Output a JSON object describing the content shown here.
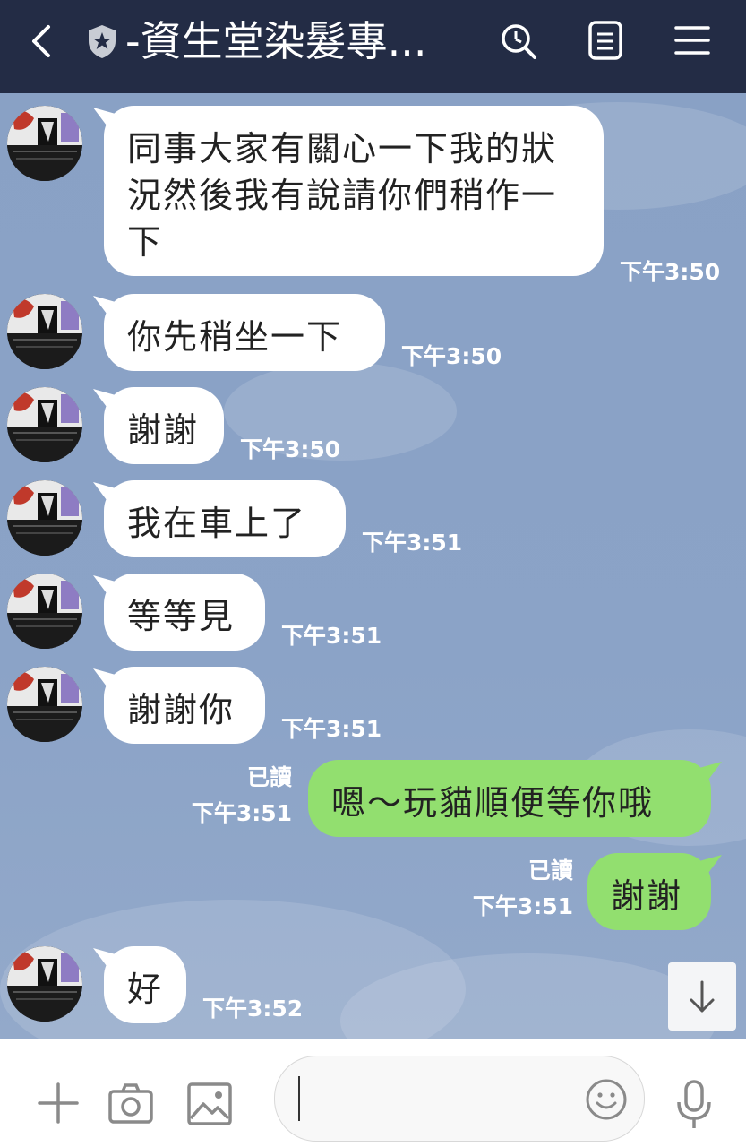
{
  "header": {
    "title": "-資生堂染髮專..."
  },
  "icons": {
    "back": "back-chevron-icon",
    "verified": "shield-star-icon",
    "search": "search-icon",
    "notes": "notes-icon",
    "menu": "menu-icon",
    "scroll_down": "arrow-down-icon",
    "add": "plus-icon",
    "camera": "camera-icon",
    "image": "image-icon",
    "emoji": "emoji-icon",
    "mic": "microphone-icon"
  },
  "colors": {
    "header_bg": "#232c45",
    "chat_bg": "#8aa2c6",
    "incoming_bubble": "#ffffff",
    "outgoing_bubble": "#92df6f"
  },
  "messages": [
    {
      "direction": "in",
      "text": "同事大家有關心一下我的狀況然後我有說請你們稍作一下",
      "time": "下午3:50"
    },
    {
      "direction": "in",
      "text": "你先稍坐一下",
      "time": "下午3:50"
    },
    {
      "direction": "in",
      "text": "謝謝",
      "time": "下午3:50"
    },
    {
      "direction": "in",
      "text": "我在車上了",
      "time": "下午3:51"
    },
    {
      "direction": "in",
      "text": "等等見",
      "time": "下午3:51"
    },
    {
      "direction": "in",
      "text": "謝謝你",
      "time": "下午3:51"
    },
    {
      "direction": "out",
      "text": "嗯～玩貓順便等你哦",
      "time": "下午3:51",
      "status": "已讀"
    },
    {
      "direction": "out",
      "text": "謝謝",
      "time": "下午3:51",
      "status": "已讀"
    },
    {
      "direction": "in",
      "text": "好",
      "time": "下午3:52"
    }
  ],
  "input": {
    "value": ""
  }
}
